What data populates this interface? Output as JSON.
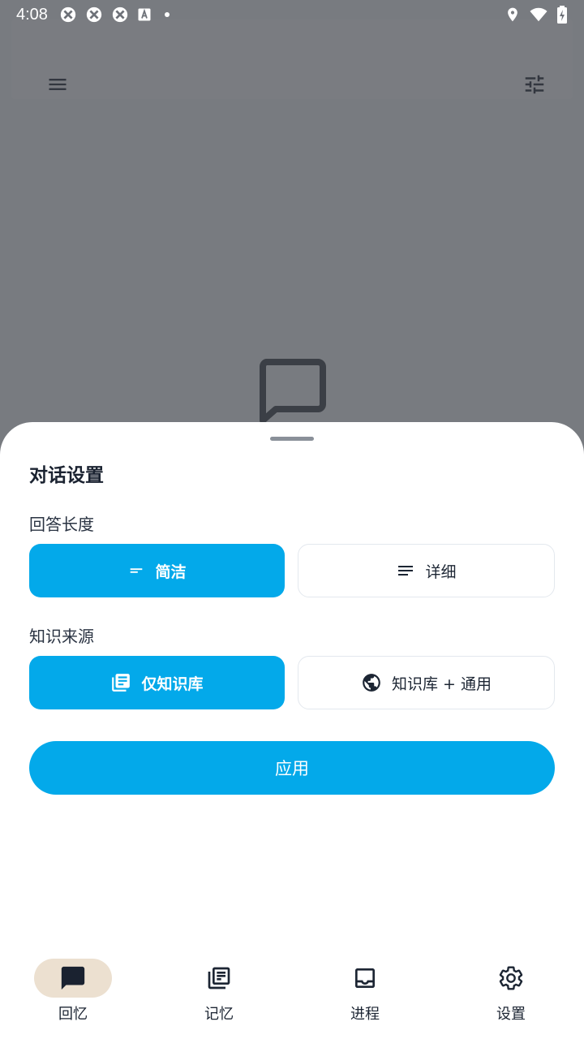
{
  "status_bar": {
    "time": "4:08",
    "left_icons": [
      "app-notification-icon",
      "app-notification-icon",
      "app-notification-icon",
      "font-a-icon",
      "dot-icon"
    ],
    "right_icons": [
      "location-icon",
      "wifi-icon",
      "battery-charging-icon"
    ]
  },
  "background": {
    "toolbar_left_icon": "menu-icon",
    "toolbar_right_icon": "tune-icon",
    "empty_state_icon": "chat-bubble-icon"
  },
  "sheet": {
    "title": "对话设置",
    "answer_length": {
      "label": "回答长度",
      "options": [
        {
          "label": "简洁",
          "icon": "short-text-icon",
          "selected": true
        },
        {
          "label": "详细",
          "icon": "notes-icon",
          "selected": false
        }
      ]
    },
    "knowledge_source": {
      "label": "知识来源",
      "options": [
        {
          "label": "仅知识库",
          "icon": "library-books-icon",
          "selected": true
        },
        {
          "label": "知识库 + 通用",
          "icon": "globe-icon",
          "selected": false
        }
      ]
    },
    "apply_label": "应用"
  },
  "nav": {
    "items": [
      {
        "label": "回忆",
        "icon": "chat-icon",
        "active": true
      },
      {
        "label": "记忆",
        "icon": "library-icon",
        "active": false
      },
      {
        "label": "进程",
        "icon": "inbox-icon",
        "active": false
      },
      {
        "label": "设置",
        "icon": "gear-icon",
        "active": false
      }
    ]
  },
  "colors": {
    "accent": "#03a9ea",
    "nav_active_pill": "#ece0d0",
    "scrim": "#3c4046"
  }
}
